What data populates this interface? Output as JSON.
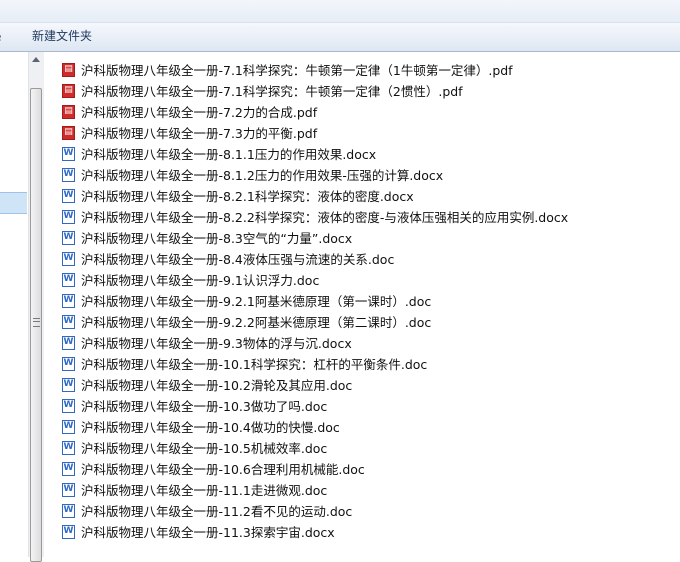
{
  "toolbar": {
    "left_edge_text": "e",
    "new_folder_label": "新建文件夹"
  },
  "files": [
    {
      "name": "沪科版物理八年级全一册-7.1科学探究：牛顿第一定律（1牛顿第一定律）.pdf",
      "icon": "pdf-icon"
    },
    {
      "name": "沪科版物理八年级全一册-7.1科学探究：牛顿第一定律（2惯性）.pdf",
      "icon": "pdf-icon"
    },
    {
      "name": "沪科版物理八年级全一册-7.2力的合成.pdf",
      "icon": "pdf-icon"
    },
    {
      "name": "沪科版物理八年级全一册-7.3力的平衡.pdf",
      "icon": "pdf-icon"
    },
    {
      "name": "沪科版物理八年级全一册-8.1.1压力的作用效果.docx",
      "icon": "word-icon"
    },
    {
      "name": "沪科版物理八年级全一册-8.1.2压力的作用效果-压强的计算.docx",
      "icon": "word-icon"
    },
    {
      "name": "沪科版物理八年级全一册-8.2.1科学探究：液体的密度.docx",
      "icon": "word-icon"
    },
    {
      "name": "沪科版物理八年级全一册-8.2.2科学探究：液体的密度-与液体压强相关的应用实例.docx",
      "icon": "word-icon"
    },
    {
      "name": "沪科版物理八年级全一册-8.3空气的“力量”.docx",
      "icon": "word-icon"
    },
    {
      "name": "沪科版物理八年级全一册-8.4液体压强与流速的关系.doc",
      "icon": "word-icon"
    },
    {
      "name": "沪科版物理八年级全一册-9.1认识浮力.doc",
      "icon": "word-icon"
    },
    {
      "name": "沪科版物理八年级全一册-9.2.1阿基米德原理（第一课时）.doc",
      "icon": "word-icon"
    },
    {
      "name": "沪科版物理八年级全一册-9.2.2阿基米德原理（第二课时）.doc",
      "icon": "word-icon"
    },
    {
      "name": "沪科版物理八年级全一册-9.3物体的浮与沉.docx",
      "icon": "word-icon"
    },
    {
      "name": "沪科版物理八年级全一册-10.1科学探究：杠杆的平衡条件.doc",
      "icon": "word-icon"
    },
    {
      "name": "沪科版物理八年级全一册-10.2滑轮及其应用.doc",
      "icon": "word-icon"
    },
    {
      "name": "沪科版物理八年级全一册-10.3做功了吗.doc",
      "icon": "word-icon"
    },
    {
      "name": "沪科版物理八年级全一册-10.4做功的快慢.doc",
      "icon": "word-icon"
    },
    {
      "name": "沪科版物理八年级全一册-10.5机械效率.doc",
      "icon": "word-icon"
    },
    {
      "name": "沪科版物理八年级全一册-10.6合理利用机械能.doc",
      "icon": "word-icon"
    },
    {
      "name": "沪科版物理八年级全一册-11.1走进微观.doc",
      "icon": "word-icon"
    },
    {
      "name": "沪科版物理八年级全一册-11.2看不见的运动.doc",
      "icon": "word-icon"
    },
    {
      "name": "沪科版物理八年级全一册-11.3探索宇宙.docx",
      "icon": "word-icon"
    }
  ]
}
